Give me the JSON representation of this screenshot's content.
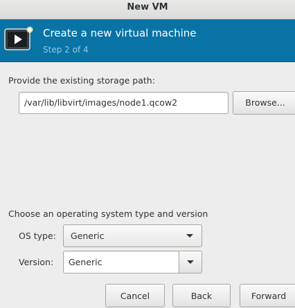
{
  "window": {
    "title": "New VM"
  },
  "banner": {
    "icon": "vm-screen-icon",
    "title": "Create a new virtual machine",
    "step": "Step 2 of 4"
  },
  "storage": {
    "label": "Provide the existing storage path:",
    "path_value": "/var/lib/libvirt/images/node1.qcow2",
    "browse_label": "Browse..."
  },
  "os": {
    "section_label": "Choose an operating system type and version",
    "type_label": "OS type:",
    "type_value": "Generic",
    "version_label": "Version:",
    "version_value": "Generic"
  },
  "buttons": {
    "cancel": "Cancel",
    "back": "Back",
    "forward": "Forward"
  },
  "colors": {
    "banner": "#0a73a6",
    "step_text": "#8fc9e8"
  }
}
